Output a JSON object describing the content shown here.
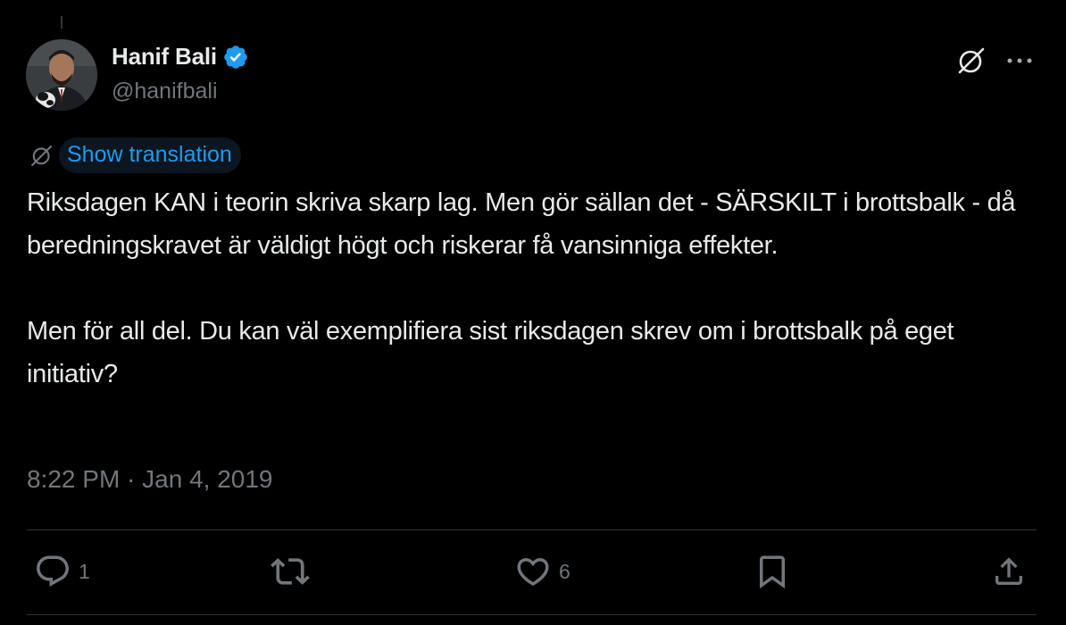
{
  "author": {
    "display_name": "Hanif Bali",
    "handle": "@hanifbali",
    "verified": true
  },
  "translate": {
    "label": "Show translation"
  },
  "tweet": {
    "paragraphs": [
      "Riksdagen KAN i teorin skriva skarp lag. Men gör sällan det - SÄRSKILT i brottsbalk - då beredningskravet är väldigt högt och riskerar få vansinniga effekter.",
      "Men för all del. Du kan väl exemplifiera sist riksdagen skrev om i brottsbalk på eget initiativ?"
    ],
    "timestamp": "8:22 PM · Jan 4, 2019"
  },
  "actions": {
    "replies": "1",
    "likes": "6"
  },
  "icons": {
    "verified": "verified-badge-icon",
    "grok": "grok-icon",
    "more": "more-dots-icon",
    "translate": "translate-icon",
    "reply": "reply-icon",
    "retweet": "retweet-icon",
    "like": "heart-icon",
    "bookmark": "bookmark-icon",
    "share": "share-icon"
  },
  "colors": {
    "background": "#000000",
    "text": "#e7e9ea",
    "secondary": "#71767b",
    "accent": "#1d9bf0",
    "divider": "#2f3336"
  }
}
